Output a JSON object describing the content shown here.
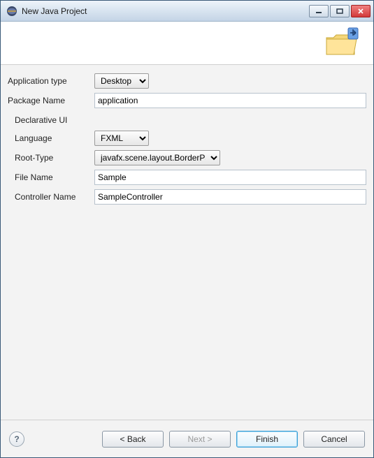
{
  "window": {
    "title": "New Java Project"
  },
  "form": {
    "appType": {
      "label": "Application type",
      "value": "Desktop"
    },
    "packageName": {
      "label": "Package Name",
      "value": "application"
    },
    "groupLabel": "Declarative UI",
    "language": {
      "label": "Language",
      "value": "FXML"
    },
    "rootType": {
      "label": "Root-Type",
      "value": "javafx.scene.layout.BorderPane"
    },
    "fileName": {
      "label": "File Name",
      "value": "Sample"
    },
    "controllerName": {
      "label": "Controller Name",
      "value": "SampleController"
    }
  },
  "footer": {
    "back": "< Back",
    "next": "Next >",
    "finish": "Finish",
    "cancel": "Cancel"
  }
}
